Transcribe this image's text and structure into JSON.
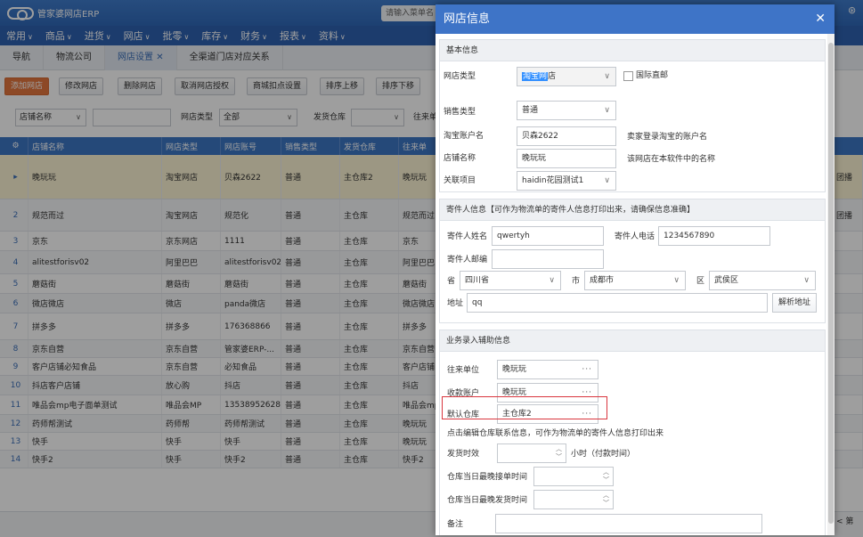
{
  "app": {
    "logo_text": "管家婆网店ERP",
    "search_placeholder": "请输入菜单名"
  },
  "menu": [
    "常用",
    "商品",
    "进货",
    "网店",
    "批零",
    "库存",
    "财务",
    "报表",
    "资料"
  ],
  "tabs": [
    {
      "label": "导航"
    },
    {
      "label": "物流公司"
    },
    {
      "label": "网店设置",
      "closable": true
    },
    {
      "label": "全渠道门店对应关系"
    }
  ],
  "toolbar": [
    "添加网店",
    "修改网店",
    "删除网店",
    "取消网店授权",
    "商城扣点设置",
    "排序上移",
    "排序下移"
  ],
  "filters": {
    "field_select": "店铺名称",
    "shop_type_label": "网店类型",
    "shop_type_value": "全部",
    "warehouse_label": "发货仓库",
    "partner_label": "往来单"
  },
  "grid": {
    "columns": [
      "店铺名称",
      "网店类型",
      "网店账号",
      "销售类型",
      "发货仓库",
      "往来单"
    ],
    "rows": [
      {
        "num": "▸",
        "name": "晚玩玩",
        "type": "淘宝网店",
        "account": "贝森2622",
        "sale": "普通",
        "wh": "主仓库2",
        "partner": "晚玩玩",
        "tail": "团播"
      },
      {
        "num": "2",
        "name": "规范而过",
        "type": "淘宝网店",
        "account": "规范化",
        "sale": "普通",
        "wh": "主仓库",
        "partner": "规范而过",
        "tail": "团播"
      },
      {
        "num": "3",
        "name": "京东",
        "type": "京东网店",
        "account": "1111",
        "sale": "普通",
        "wh": "主仓库",
        "partner": "京东",
        "tail": ""
      },
      {
        "num": "4",
        "name": "alitestforisv02",
        "type": "阿里巴巴",
        "account": "alitestforisv02",
        "sale": "普通",
        "wh": "主仓库",
        "partner": "阿里巴巴",
        "tail": ""
      },
      {
        "num": "5",
        "name": "蘑菇街",
        "type": "蘑菇街",
        "account": "蘑菇街",
        "sale": "普通",
        "wh": "主仓库",
        "partner": "蘑菇街",
        "tail": ""
      },
      {
        "num": "6",
        "name": "微店微店",
        "type": "微店",
        "account": "panda微店",
        "sale": "普通",
        "wh": "主仓库",
        "partner": "微店微店",
        "tail": ""
      },
      {
        "num": "7",
        "name": "拼多多",
        "type": "拼多多",
        "account": "176368866",
        "sale": "普通",
        "wh": "主仓库",
        "partner": "拼多多",
        "tail": ""
      },
      {
        "num": "8",
        "name": "京东自营",
        "type": "京东自营",
        "account": "管家婆ERP-...",
        "sale": "普通",
        "wh": "主仓库",
        "partner": "京东自营",
        "tail": ""
      },
      {
        "num": "9",
        "name": "客户店铺必知食品",
        "type": "京东自营",
        "account": "必知食品",
        "sale": "普通",
        "wh": "主仓库",
        "partner": "客户店铺",
        "tail": ""
      },
      {
        "num": "10",
        "name": "抖店客户店铺",
        "type": "放心购",
        "account": "抖店",
        "sale": "普通",
        "wh": "主仓库",
        "partner": "抖店",
        "tail": ""
      },
      {
        "num": "11",
        "name": "唯品会mp电子面单测试",
        "type": "唯品会MP",
        "account": "13538952628",
        "sale": "普通",
        "wh": "主仓库",
        "partner": "唯品会mp",
        "tail": ""
      },
      {
        "num": "12",
        "name": "药师帮测试",
        "type": "药师帮",
        "account": "药师帮测试",
        "sale": "普通",
        "wh": "主仓库",
        "partner": "晚玩玩",
        "tail": ""
      },
      {
        "num": "13",
        "name": "快手",
        "type": "快手",
        "account": "快手",
        "sale": "普通",
        "wh": "主仓库",
        "partner": "晚玩玩",
        "tail": ""
      },
      {
        "num": "14",
        "name": "快手2",
        "type": "快手",
        "account": "快手2",
        "sale": "普通",
        "wh": "主仓库",
        "partner": "快手2",
        "tail": ""
      }
    ]
  },
  "pager": "< 第",
  "dialog": {
    "title": "网店信息",
    "basic": {
      "title": "基本信息",
      "shop_type_label": "网店类型",
      "shop_type_value": "淘宝网店",
      "shop_type_sel": "淘宝网",
      "shop_type_rest": "店",
      "intl_label": "国际直邮",
      "sale_label": "销售类型",
      "sale_value": "普通",
      "account_label": "淘宝账户名",
      "account_value": "贝森2622",
      "account_hint": "卖家登录淘宝的账户名",
      "name_label": "店铺名称",
      "name_value": "晚玩玩",
      "name_hint": "该网店在本软件中的名称",
      "project_label": "关联项目",
      "project_value": "haidin花园测试1"
    },
    "sender": {
      "title": "寄件人信息【可作为物流单的寄件人信息打印出来，请确保信息准确】",
      "name_label": "寄件人姓名",
      "name_value": "qwertyh",
      "phone_label": "寄件人电话",
      "phone_value": "1234567890",
      "zip_label": "寄件人邮编",
      "zip_value": "",
      "prov_label": "省",
      "prov_value": "四川省",
      "city_label": "市",
      "city_value": "成都市",
      "dist_label": "区",
      "dist_value": "武侯区",
      "addr_label": "地址",
      "addr_value": "qq",
      "parse_btn": "解析地址"
    },
    "biz": {
      "title": "业务录入辅助信息",
      "partner_label": "往来单位",
      "partner_value": "晚玩玩",
      "account_label": "收款账户",
      "account_value": "晚玩玩",
      "wh_label": "默认仓库",
      "wh_value": "主仓库2",
      "wh_tip": "点击编辑仓库联系信息，可作为物流单的寄件人信息打印出来",
      "ship_label": "发货时效",
      "ship_value": "",
      "ship_unit": "小时（付款时间）",
      "order_label": "仓库当日最晚接单时间",
      "order_value": "",
      "send_label": "仓库当日最晚发货时间",
      "send_value": "",
      "remark_label": "备注",
      "remark_value": ""
    }
  }
}
